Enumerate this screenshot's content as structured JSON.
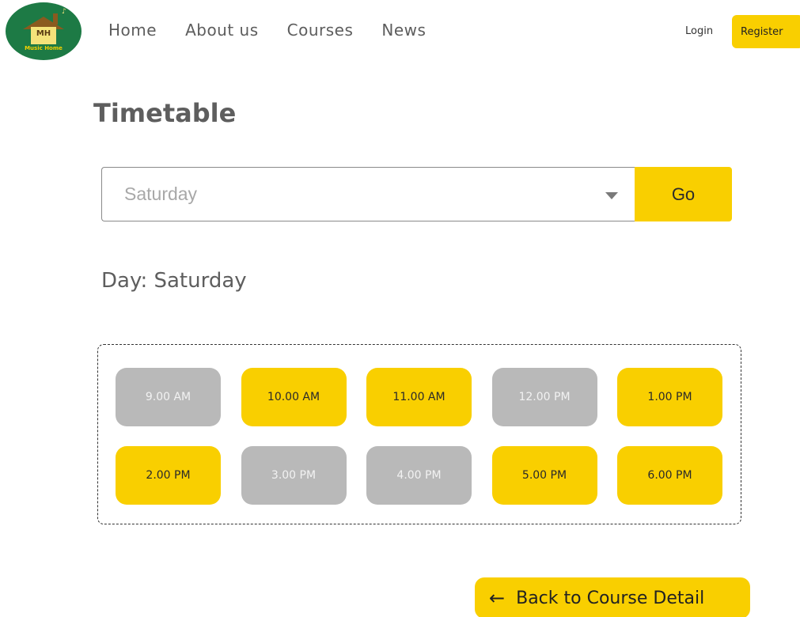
{
  "brand": {
    "logo_text": "MH",
    "logo_caption": "Music Home",
    "logo_color": "#1d7a45"
  },
  "nav": {
    "items": [
      "Home",
      "About us",
      "Courses",
      "News"
    ],
    "login_label": "Login",
    "register_label": "Register"
  },
  "main": {
    "title": "Timetable",
    "select": {
      "value": "Saturday"
    },
    "go_label": "Go",
    "day_label": "Day: Saturday",
    "slots": [
      {
        "label": "9.00 AM",
        "available": false
      },
      {
        "label": "10.00 AM",
        "available": true
      },
      {
        "label": "11.00 AM",
        "available": true
      },
      {
        "label": "12.00 PM",
        "available": false
      },
      {
        "label": "1.00 PM",
        "available": true
      },
      {
        "label": "2.00 PM",
        "available": true
      },
      {
        "label": "3.00 PM",
        "available": false
      },
      {
        "label": "4.00 PM",
        "available": false
      },
      {
        "label": "5.00 PM",
        "available": true
      },
      {
        "label": "6.00 PM",
        "available": true
      }
    ],
    "back_label": "Back to Course Detail",
    "back_icon": "arrow-left-icon"
  },
  "colors": {
    "accent": "#f9cf00",
    "unavailable": "#b9b9b9",
    "text": "#5e5e5e"
  }
}
